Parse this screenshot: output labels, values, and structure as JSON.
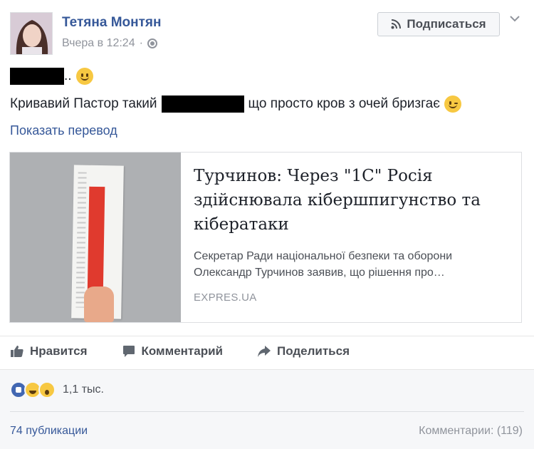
{
  "post": {
    "author": "Тетяна Монтян",
    "timestamp": "Вчера в 12:24",
    "privacy_icon": "globe-icon",
    "subscribe_label": "Подписаться",
    "line1_suffix": "..",
    "line2_prefix": "Кривавий Пастор такий",
    "line2_suffix": "що просто кров з очей бризгає",
    "translate_link": "Показать перевод"
  },
  "link_card": {
    "title": "Турчинов: Через \"1С\" Росія здійснювала кібершпигунство та кібератаки",
    "description": "Секретар Ради національної безпеки та оборони Олександр Турчинов заявив, що рішення про…",
    "source": "EXPRES.UA"
  },
  "actions": {
    "like": "Нравится",
    "comment": "Комментарий",
    "share": "Поделиться"
  },
  "stats": {
    "reactions_count": "1,1 тыс.",
    "shares": "74 публикации",
    "comments": "Комментарии: (119)"
  },
  "colors": {
    "link_blue": "#365899",
    "like_blue": "#4267b2",
    "muted_gray": "#90949c"
  }
}
